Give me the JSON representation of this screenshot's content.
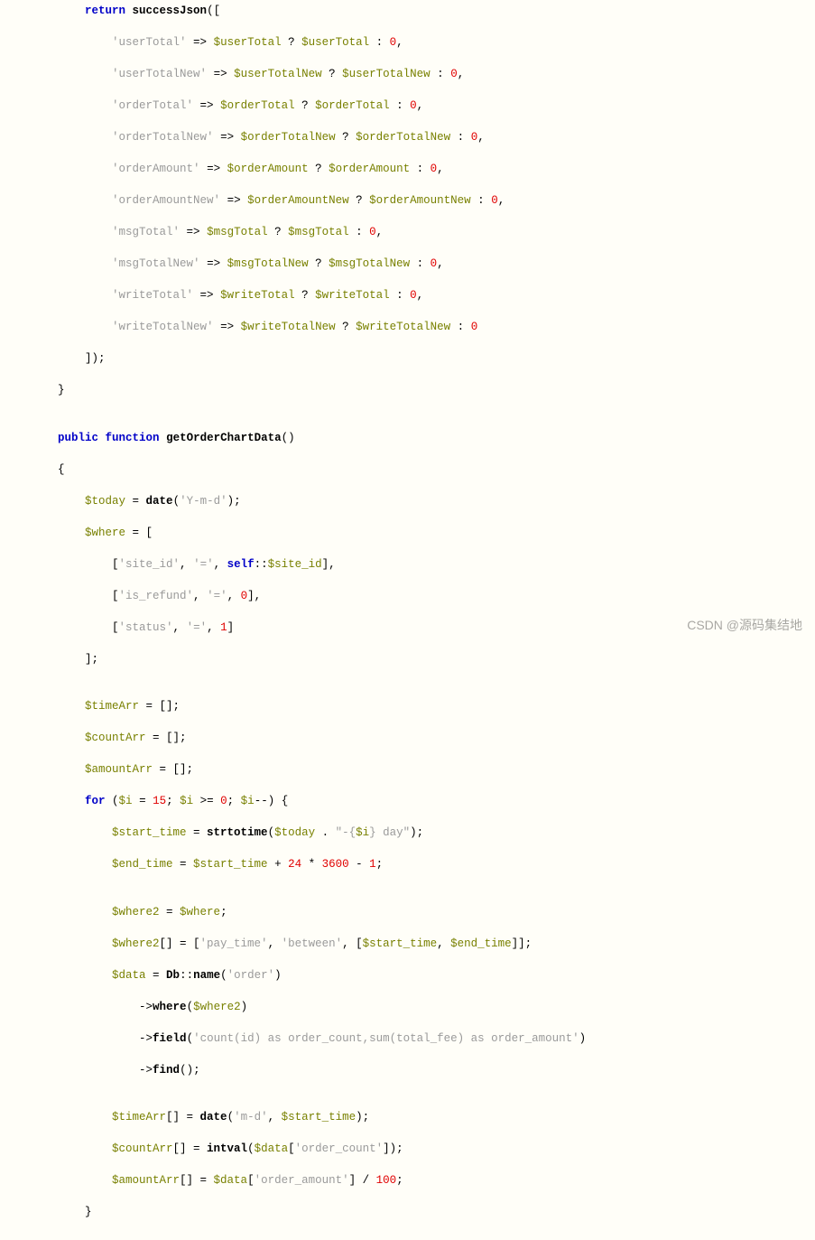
{
  "watermark": "CSDN @源码集结地",
  "code": {
    "lines": [
      [
        [
          "pad",
          "        "
        ],
        [
          "kw",
          "return"
        ],
        [
          "op",
          " "
        ],
        [
          "fn",
          "successJson"
        ],
        [
          "op",
          "(["
        ]
      ],
      [
        [
          "pad",
          "            "
        ],
        [
          "str",
          "'userTotal'"
        ],
        [
          "op",
          " "
        ],
        [
          "arrow",
          "=>"
        ],
        [
          "op",
          " "
        ],
        [
          "var",
          "$userTotal"
        ],
        [
          "op",
          " ? "
        ],
        [
          "var",
          "$userTotal"
        ],
        [
          "op",
          " : "
        ],
        [
          "num",
          "0"
        ],
        [
          "op",
          ","
        ]
      ],
      [
        [
          "pad",
          "            "
        ],
        [
          "str",
          "'userTotalNew'"
        ],
        [
          "op",
          " "
        ],
        [
          "arrow",
          "=>"
        ],
        [
          "op",
          " "
        ],
        [
          "var",
          "$userTotalNew"
        ],
        [
          "op",
          " ? "
        ],
        [
          "var",
          "$userTotalNew"
        ],
        [
          "op",
          " : "
        ],
        [
          "num",
          "0"
        ],
        [
          "op",
          ","
        ]
      ],
      [
        [
          "pad",
          "            "
        ],
        [
          "str",
          "'orderTotal'"
        ],
        [
          "op",
          " "
        ],
        [
          "arrow",
          "=>"
        ],
        [
          "op",
          " "
        ],
        [
          "var",
          "$orderTotal"
        ],
        [
          "op",
          " ? "
        ],
        [
          "var",
          "$orderTotal"
        ],
        [
          "op",
          " : "
        ],
        [
          "num",
          "0"
        ],
        [
          "op",
          ","
        ]
      ],
      [
        [
          "pad",
          "            "
        ],
        [
          "str",
          "'orderTotalNew'"
        ],
        [
          "op",
          " "
        ],
        [
          "arrow",
          "=>"
        ],
        [
          "op",
          " "
        ],
        [
          "var",
          "$orderTotalNew"
        ],
        [
          "op",
          " ? "
        ],
        [
          "var",
          "$orderTotalNew"
        ],
        [
          "op",
          " : "
        ],
        [
          "num",
          "0"
        ],
        [
          "op",
          ","
        ]
      ],
      [
        [
          "pad",
          "            "
        ],
        [
          "str",
          "'orderAmount'"
        ],
        [
          "op",
          " "
        ],
        [
          "arrow",
          "=>"
        ],
        [
          "op",
          " "
        ],
        [
          "var",
          "$orderAmount"
        ],
        [
          "op",
          " ? "
        ],
        [
          "var",
          "$orderAmount"
        ],
        [
          "op",
          " : "
        ],
        [
          "num",
          "0"
        ],
        [
          "op",
          ","
        ]
      ],
      [
        [
          "pad",
          "            "
        ],
        [
          "str",
          "'orderAmountNew'"
        ],
        [
          "op",
          " "
        ],
        [
          "arrow",
          "=>"
        ],
        [
          "op",
          " "
        ],
        [
          "var",
          "$orderAmountNew"
        ],
        [
          "op",
          " ? "
        ],
        [
          "var",
          "$orderAmountNew"
        ],
        [
          "op",
          " : "
        ],
        [
          "num",
          "0"
        ],
        [
          "op",
          ","
        ]
      ],
      [
        [
          "pad",
          "            "
        ],
        [
          "str",
          "'msgTotal'"
        ],
        [
          "op",
          " "
        ],
        [
          "arrow",
          "=>"
        ],
        [
          "op",
          " "
        ],
        [
          "var",
          "$msgTotal"
        ],
        [
          "op",
          " ? "
        ],
        [
          "var",
          "$msgTotal"
        ],
        [
          "op",
          " : "
        ],
        [
          "num",
          "0"
        ],
        [
          "op",
          ","
        ]
      ],
      [
        [
          "pad",
          "            "
        ],
        [
          "str",
          "'msgTotalNew'"
        ],
        [
          "op",
          " "
        ],
        [
          "arrow",
          "=>"
        ],
        [
          "op",
          " "
        ],
        [
          "var",
          "$msgTotalNew"
        ],
        [
          "op",
          " ? "
        ],
        [
          "var",
          "$msgTotalNew"
        ],
        [
          "op",
          " : "
        ],
        [
          "num",
          "0"
        ],
        [
          "op",
          ","
        ]
      ],
      [
        [
          "pad",
          "            "
        ],
        [
          "str",
          "'writeTotal'"
        ],
        [
          "op",
          " "
        ],
        [
          "arrow",
          "=>"
        ],
        [
          "op",
          " "
        ],
        [
          "var",
          "$writeTotal"
        ],
        [
          "op",
          " ? "
        ],
        [
          "var",
          "$writeTotal"
        ],
        [
          "op",
          " : "
        ],
        [
          "num",
          "0"
        ],
        [
          "op",
          ","
        ]
      ],
      [
        [
          "pad",
          "            "
        ],
        [
          "str",
          "'writeTotalNew'"
        ],
        [
          "op",
          " "
        ],
        [
          "arrow",
          "=>"
        ],
        [
          "op",
          " "
        ],
        [
          "var",
          "$writeTotalNew"
        ],
        [
          "op",
          " ? "
        ],
        [
          "var",
          "$writeTotalNew"
        ],
        [
          "op",
          " : "
        ],
        [
          "num",
          "0"
        ]
      ],
      [
        [
          "pad",
          "        "
        ],
        [
          "op",
          "]);"
        ]
      ],
      [
        [
          "pad",
          "    "
        ],
        [
          "op",
          "}"
        ]
      ],
      [
        [
          "pad",
          ""
        ]
      ],
      [
        [
          "pad",
          "    "
        ],
        [
          "kw",
          "public"
        ],
        [
          "op",
          " "
        ],
        [
          "kw",
          "function"
        ],
        [
          "op",
          " "
        ],
        [
          "fn",
          "getOrderChartData"
        ],
        [
          "op",
          "()"
        ]
      ],
      [
        [
          "pad",
          "    "
        ],
        [
          "op",
          "{"
        ]
      ],
      [
        [
          "pad",
          "        "
        ],
        [
          "var",
          "$today"
        ],
        [
          "op",
          " = "
        ],
        [
          "fn",
          "date"
        ],
        [
          "op",
          "("
        ],
        [
          "str",
          "'Y-m-d'"
        ],
        [
          "op",
          ");"
        ]
      ],
      [
        [
          "pad",
          "        "
        ],
        [
          "var",
          "$where"
        ],
        [
          "op",
          " = ["
        ]
      ],
      [
        [
          "pad",
          "            "
        ],
        [
          "op",
          "["
        ],
        [
          "str",
          "'site_id'"
        ],
        [
          "op",
          ", "
        ],
        [
          "str",
          "'='"
        ],
        [
          "op",
          ", "
        ],
        [
          "kw",
          "self"
        ],
        [
          "op",
          "::"
        ],
        [
          "var",
          "$site_id"
        ],
        [
          "op",
          "],"
        ]
      ],
      [
        [
          "pad",
          "            "
        ],
        [
          "op",
          "["
        ],
        [
          "str",
          "'is_refund'"
        ],
        [
          "op",
          ", "
        ],
        [
          "str",
          "'='"
        ],
        [
          "op",
          ", "
        ],
        [
          "num",
          "0"
        ],
        [
          "op",
          "],"
        ]
      ],
      [
        [
          "pad",
          "            "
        ],
        [
          "op",
          "["
        ],
        [
          "str",
          "'status'"
        ],
        [
          "op",
          ", "
        ],
        [
          "str",
          "'='"
        ],
        [
          "op",
          ", "
        ],
        [
          "num",
          "1"
        ],
        [
          "op",
          "]"
        ]
      ],
      [
        [
          "pad",
          "        "
        ],
        [
          "op",
          "];"
        ]
      ],
      [
        [
          "pad",
          ""
        ]
      ],
      [
        [
          "pad",
          "        "
        ],
        [
          "var",
          "$timeArr"
        ],
        [
          "op",
          " = [];"
        ]
      ],
      [
        [
          "pad",
          "        "
        ],
        [
          "var",
          "$countArr"
        ],
        [
          "op",
          " = [];"
        ]
      ],
      [
        [
          "pad",
          "        "
        ],
        [
          "var",
          "$amountArr"
        ],
        [
          "op",
          " = [];"
        ]
      ],
      [
        [
          "pad",
          "        "
        ],
        [
          "kw",
          "for"
        ],
        [
          "op",
          " ("
        ],
        [
          "var",
          "$i"
        ],
        [
          "op",
          " = "
        ],
        [
          "num",
          "15"
        ],
        [
          "op",
          "; "
        ],
        [
          "var",
          "$i"
        ],
        [
          "op",
          " >= "
        ],
        [
          "num",
          "0"
        ],
        [
          "op",
          "; "
        ],
        [
          "var",
          "$i"
        ],
        [
          "op",
          "--) {"
        ]
      ],
      [
        [
          "pad",
          "            "
        ],
        [
          "var",
          "$start_time"
        ],
        [
          "op",
          " = "
        ],
        [
          "fn",
          "strtotime"
        ],
        [
          "op",
          "("
        ],
        [
          "var",
          "$today"
        ],
        [
          "op",
          " . "
        ],
        [
          "str",
          "\"-{"
        ],
        [
          "var",
          "$i"
        ],
        [
          "str",
          "} day\""
        ],
        [
          "op",
          ");"
        ]
      ],
      [
        [
          "pad",
          "            "
        ],
        [
          "var",
          "$end_time"
        ],
        [
          "op",
          " = "
        ],
        [
          "var",
          "$start_time"
        ],
        [
          "op",
          " + "
        ],
        [
          "num",
          "24"
        ],
        [
          "op",
          " * "
        ],
        [
          "num",
          "3600"
        ],
        [
          "op",
          " - "
        ],
        [
          "num",
          "1"
        ],
        [
          "op",
          ";"
        ]
      ],
      [
        [
          "pad",
          ""
        ]
      ],
      [
        [
          "pad",
          "            "
        ],
        [
          "var",
          "$where2"
        ],
        [
          "op",
          " = "
        ],
        [
          "var",
          "$where"
        ],
        [
          "op",
          ";"
        ]
      ],
      [
        [
          "pad",
          "            "
        ],
        [
          "var",
          "$where2"
        ],
        [
          "op",
          "[] = ["
        ],
        [
          "str",
          "'pay_time'"
        ],
        [
          "op",
          ", "
        ],
        [
          "str",
          "'between'"
        ],
        [
          "op",
          ", ["
        ],
        [
          "var",
          "$start_time"
        ],
        [
          "op",
          ", "
        ],
        [
          "var",
          "$end_time"
        ],
        [
          "op",
          "]];"
        ]
      ],
      [
        [
          "pad",
          "            "
        ],
        [
          "var",
          "$data"
        ],
        [
          "op",
          " = "
        ],
        [
          "fn",
          "Db"
        ],
        [
          "op",
          "::"
        ],
        [
          "fn",
          "name"
        ],
        [
          "op",
          "("
        ],
        [
          "str",
          "'order'"
        ],
        [
          "op",
          ")"
        ]
      ],
      [
        [
          "pad",
          "                "
        ],
        [
          "arrow",
          "->"
        ],
        [
          "fn",
          "where"
        ],
        [
          "op",
          "("
        ],
        [
          "var",
          "$where2"
        ],
        [
          "op",
          ")"
        ]
      ],
      [
        [
          "pad",
          "                "
        ],
        [
          "arrow",
          "->"
        ],
        [
          "fn",
          "field"
        ],
        [
          "op",
          "("
        ],
        [
          "str",
          "'count(id) as order_count,sum(total_fee) as order_amount'"
        ],
        [
          "op",
          ")"
        ]
      ],
      [
        [
          "pad",
          "                "
        ],
        [
          "arrow",
          "->"
        ],
        [
          "fn",
          "find"
        ],
        [
          "op",
          "();"
        ]
      ],
      [
        [
          "pad",
          ""
        ]
      ],
      [
        [
          "pad",
          "            "
        ],
        [
          "var",
          "$timeArr"
        ],
        [
          "op",
          "[] = "
        ],
        [
          "fn",
          "date"
        ],
        [
          "op",
          "("
        ],
        [
          "str",
          "'m-d'"
        ],
        [
          "op",
          ", "
        ],
        [
          "var",
          "$start_time"
        ],
        [
          "op",
          ");"
        ]
      ],
      [
        [
          "pad",
          "            "
        ],
        [
          "var",
          "$countArr"
        ],
        [
          "op",
          "[] = "
        ],
        [
          "fn",
          "intval"
        ],
        [
          "op",
          "("
        ],
        [
          "var",
          "$data"
        ],
        [
          "op",
          "["
        ],
        [
          "str",
          "'order_count'"
        ],
        [
          "op",
          "]);"
        ]
      ],
      [
        [
          "pad",
          "            "
        ],
        [
          "var",
          "$amountArr"
        ],
        [
          "op",
          "[] = "
        ],
        [
          "var",
          "$data"
        ],
        [
          "op",
          "["
        ],
        [
          "str",
          "'order_amount'"
        ],
        [
          "op",
          "] / "
        ],
        [
          "num",
          "100"
        ],
        [
          "op",
          ";"
        ]
      ],
      [
        [
          "pad",
          "        "
        ],
        [
          "op",
          "}"
        ]
      ]
    ]
  }
}
